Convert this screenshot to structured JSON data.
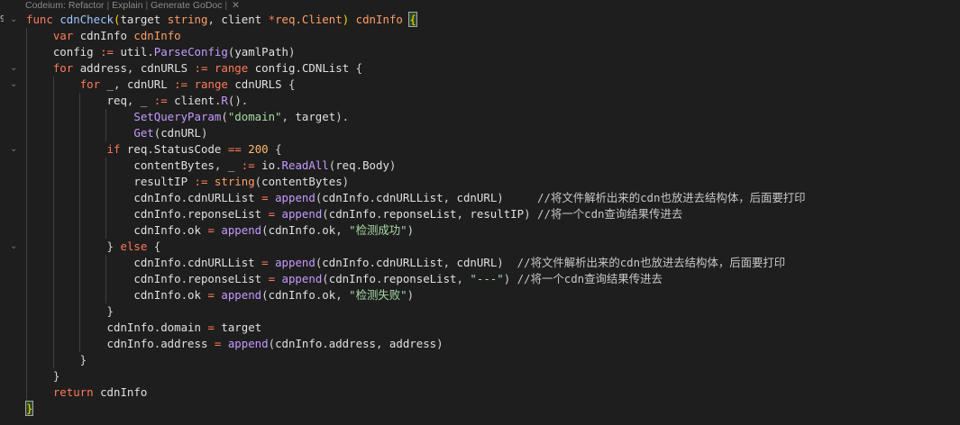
{
  "codelens": {
    "refactor": "Codeium: Refactor",
    "sep1": " | ",
    "explain": "Explain",
    "sep2": " | ",
    "godoc": "Generate GoDoc",
    "sep3": " | ",
    "close": "✕"
  },
  "gutter": {
    "first_line_number": "9"
  },
  "lines": [
    "func cdnCheck(target string, client *req.Client) cdnInfo {",
    "    var cdnInfo cdnInfo",
    "    config := util.ParseConfig(yamlPath)",
    "    for address, cdnURLS := range config.CDNList {",
    "        for _, cdnURL := range cdnURLS {",
    "            req, _ := client.R().",
    "                SetQueryParam(\"domain\", target).",
    "                Get(cdnURL)",
    "            if req.StatusCode == 200 {",
    "                contentBytes, _ := io.ReadAll(req.Body)",
    "                resultIP := string(contentBytes)",
    "                cdnInfo.cdnURLList = append(cdnInfo.cdnURLList, cdnURL)     //将文件解析出来的cdn也放进去结构体，后面要打印",
    "                cdnInfo.reponseList = append(cdnInfo.reponseList, resultIP) //将一个cdn查询结果传进去",
    "                cdnInfo.ok = append(cdnInfo.ok, \"检测成功\")",
    "            } else {",
    "                cdnInfo.cdnURLList = append(cdnInfo.cdnURLList, cdnURL)  //将文件解析出来的cdn也放进去结构体，后面要打印",
    "                cdnInfo.reponseList = append(cdnInfo.reponseList, \"---\") //将一个cdn查询结果传进去",
    "                cdnInfo.ok = append(cdnInfo.ok, \"检测失败\")",
    "            }",
    "            cdnInfo.domain = target",
    "            cdnInfo.address = append(cdnInfo.address, address)",
    "        }",
    "    }",
    "    return cdnInfo",
    "}"
  ],
  "colors": {
    "background": "#1e1e1e",
    "keyword": "#ff7a59",
    "function": "#9ec7ff",
    "string": "#a8d8a8",
    "number": "#ffb86c",
    "bracket_match": "#ffd700"
  }
}
